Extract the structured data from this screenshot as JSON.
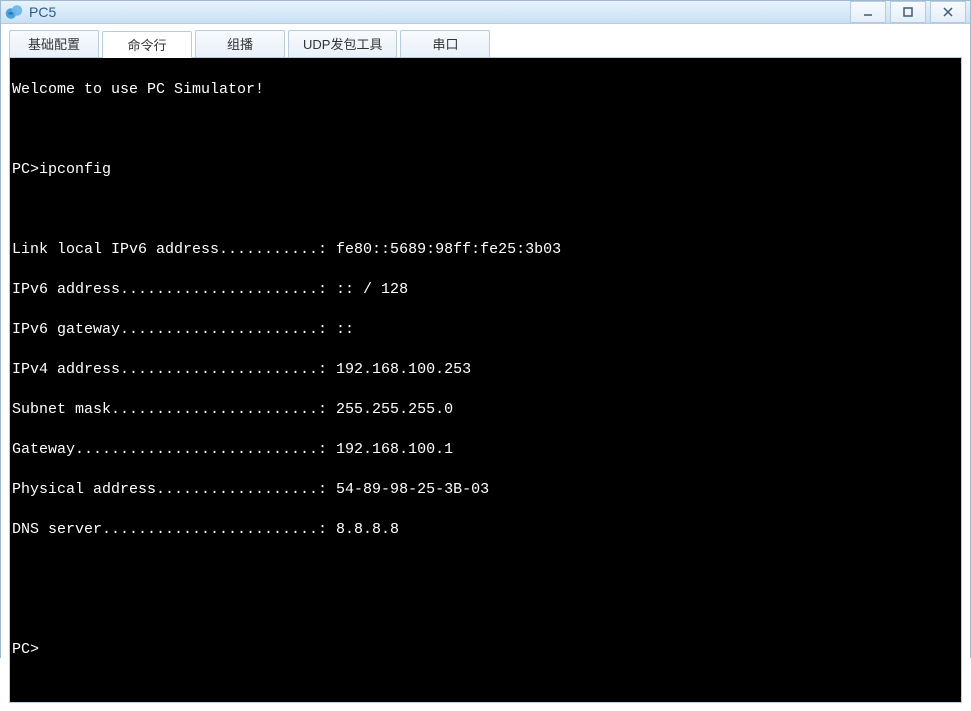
{
  "window": {
    "title": "PC5"
  },
  "tabs": {
    "basic": "基础配置",
    "cmd": "命令行",
    "multicast": "组播",
    "udp": "UDP发包工具",
    "serial": "串口"
  },
  "terminal": {
    "welcome": "Welcome to use PC Simulator!",
    "prompt1": "PC>ipconfig",
    "blank": "",
    "line_ipv6_link": "Link local IPv6 address...........: fe80::5689:98ff:fe25:3b03",
    "line_ipv6_addr": "IPv6 address......................: :: / 128",
    "line_ipv6_gw": "IPv6 gateway......................: ::",
    "line_ipv4_addr": "IPv4 address......................: 192.168.100.253",
    "line_subnet": "Subnet mask.......................: 255.255.255.0",
    "line_gw": "Gateway...........................: 192.168.100.1",
    "line_mac": "Physical address..................: 54-89-98-25-3B-03",
    "line_dns": "DNS server........................: 8.8.8.8",
    "prompt2": "PC>"
  }
}
